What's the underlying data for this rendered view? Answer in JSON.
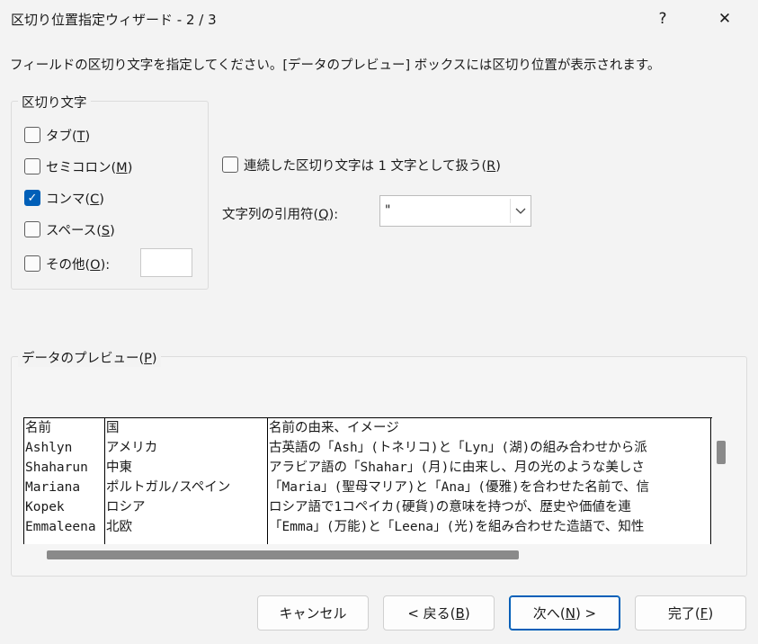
{
  "window": {
    "title": "区切り位置指定ウィザード - 2 / 3",
    "help_label": "?",
    "close_label": "✕"
  },
  "description": "フィールドの区切り文字を指定してください。[データのプレビュー] ボックスには区切り位置が表示されます。",
  "delimiters": {
    "group_title": "区切り文字",
    "tab": {
      "label": "タブ(",
      "key": "T",
      "end": ")",
      "checked": false
    },
    "semicolon": {
      "label": "セミコロン(",
      "key": "M",
      "end": ")",
      "checked": false
    },
    "comma": {
      "label": "コンマ(",
      "key": "C",
      "end": ")",
      "checked": true
    },
    "space": {
      "label": "スペース(",
      "key": "S",
      "end": ")",
      "checked": false
    },
    "other": {
      "label": "その他(",
      "key": "O",
      "end": "):",
      "checked": false,
      "value": ""
    }
  },
  "consecutive": {
    "label": "連続した区切り文字は 1 文字として扱う(",
    "key": "R",
    "end": ")",
    "checked": false
  },
  "qualifier": {
    "label": "文字列の引用符(",
    "key": "Q",
    "end": "):",
    "value": "\""
  },
  "preview": {
    "title": "データのプレビュー(",
    "key": "P",
    "end": ")",
    "col1": [
      "名前",
      "Ashlyn",
      "Shaharun",
      "Mariana",
      "Kopek",
      "Emmaleena"
    ],
    "col2": [
      "国",
      "アメリカ",
      "中東",
      "ポルトガル/スペイン",
      "ロシア",
      "北欧"
    ],
    "col3": [
      "名前の由来、イメージ",
      "古英語の「Ash」(トネリコ)と「Lyn」(湖)の組み合わせから派",
      "アラビア語の「Shahar」(月)に由来し、月の光のような美しさ",
      "「Maria」(聖母マリア)と「Ana」(優雅)を合わせた名前で、信",
      "ロシア語で1コペイカ(硬貨)の意味を持つが、歴史や価値を連",
      "「Emma」(万能)と「Leena」(光)を組み合わせた造語で、知性"
    ]
  },
  "buttons": {
    "cancel": "キャンセル",
    "back": {
      "label": "< 戻る(",
      "key": "B",
      "end": ")"
    },
    "next": {
      "label": "次へ(",
      "key": "N",
      "end": ") >"
    },
    "finish": {
      "label": "完了(",
      "key": "F",
      "end": ")"
    }
  }
}
